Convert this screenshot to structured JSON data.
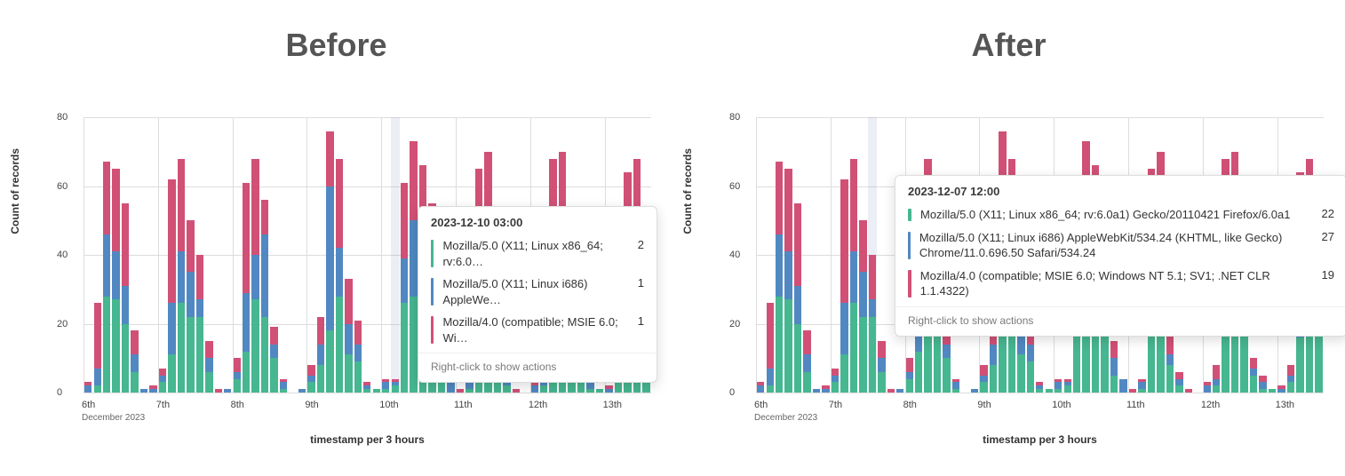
{
  "titles": {
    "before": "Before",
    "after": "After"
  },
  "axis": {
    "ylabel": "Count of records",
    "xlabel": "timestamp per 3 hours",
    "yticks": [
      0,
      20,
      40,
      60,
      80
    ],
    "ymax": 80,
    "xticks": [
      "6th",
      "7th",
      "8th",
      "9th",
      "10th",
      "11th",
      "12th",
      "13th"
    ],
    "xsub": "December 2023"
  },
  "colors": {
    "a": "#46b790",
    "b": "#5188c2",
    "c": "#d15076"
  },
  "legend_names": {
    "a": "Mozilla/5.0 (X11; Linux x86_64; rv:6.0a1) Gecko/20110421 Firefox/6.0a1",
    "b": "Mozilla/5.0 (X11; Linux i686) AppleWebKit/534.24 (KHTML, like Gecko) Chrome/11.0.696.50 Safari/534.24",
    "c": "Mozilla/4.0 (compatible; MSIE 6.0; Windows NT 5.1; SV1; .NET CLR 1.1.4322)"
  },
  "tooltips": {
    "before": {
      "title": "2023-12-10 03:00",
      "rows": [
        {
          "swatch": "a",
          "label": "Mozilla/5.0 (X11; Linux x86_64; rv:6.0…",
          "value": 2
        },
        {
          "swatch": "b",
          "label": "Mozilla/5.0 (X11; Linux i686) AppleWe…",
          "value": 1
        },
        {
          "swatch": "c",
          "label": "Mozilla/4.0 (compatible; MSIE 6.0; Wi…",
          "value": 1
        }
      ],
      "footer": "Right-click to show actions"
    },
    "after": {
      "title": "2023-12-07 12:00",
      "rows": [
        {
          "swatch": "a",
          "label": "Mozilla/5.0 (X11; Linux x86_64; rv:6.0a1) Gecko/20110421 Firefox/6.0a1",
          "value": 22
        },
        {
          "swatch": "b",
          "label": "Mozilla/5.0 (X11; Linux i686) AppleWebKit/534.24 (KHTML, like Gecko) Chrome/11.0.696.50 Safari/534.24",
          "value": 27
        },
        {
          "swatch": "c",
          "label": "Mozilla/4.0 (compatible; MSIE 6.0; Windows NT 5.1; SV1; .NET CLR 1.1.4322)",
          "value": 19
        }
      ],
      "footer": "Right-click to show actions"
    }
  },
  "chart_data": [
    {
      "id": "before",
      "type": "bar",
      "stacked": true,
      "title": "Before",
      "xlabel": "timestamp per 3 hours",
      "ylabel": "Count of records",
      "ylim": [
        0,
        80
      ],
      "x_start": "2023-12-06T00:00",
      "x_step_hours": 3,
      "x_day_ticks": [
        "6th",
        "7th",
        "8th",
        "9th",
        "10th",
        "11th",
        "12th",
        "13th"
      ],
      "x_sublabel": "December 2023",
      "series_names": [
        "Mozilla/5.0 (X11; Linux x86_64…)",
        "Mozilla/5.0 (X11; Linux i686…)",
        "Mozilla/4.0 (compatible; MSIE 6.0…)"
      ],
      "stacks": [
        {
          "a": 0,
          "b": 2,
          "c": 1
        },
        {
          "a": 2,
          "b": 5,
          "c": 19
        },
        {
          "a": 28,
          "b": 18,
          "c": 21
        },
        {
          "a": 27,
          "b": 14,
          "c": 24
        },
        {
          "a": 20,
          "b": 11,
          "c": 24
        },
        {
          "a": 6,
          "b": 5,
          "c": 7
        },
        {
          "a": 0,
          "b": 1,
          "c": 0
        },
        {
          "a": 0,
          "b": 1,
          "c": 1
        },
        {
          "a": 3,
          "b": 2,
          "c": 2
        },
        {
          "a": 11,
          "b": 15,
          "c": 36
        },
        {
          "a": 26,
          "b": 15,
          "c": 27
        },
        {
          "a": 22,
          "b": 13,
          "c": 15
        },
        {
          "a": 22,
          "b": 5,
          "c": 13
        },
        {
          "a": 6,
          "b": 4,
          "c": 5
        },
        {
          "a": 0,
          "b": 0,
          "c": 1
        },
        {
          "a": 0,
          "b": 1,
          "c": 0
        },
        {
          "a": 4,
          "b": 2,
          "c": 4
        },
        {
          "a": 12,
          "b": 17,
          "c": 32
        },
        {
          "a": 27,
          "b": 13,
          "c": 28
        },
        {
          "a": 22,
          "b": 24,
          "c": 10
        },
        {
          "a": 10,
          "b": 4,
          "c": 5
        },
        {
          "a": 1,
          "b": 2,
          "c": 1
        },
        {
          "a": 0,
          "b": 0,
          "c": 0
        },
        {
          "a": 0,
          "b": 1,
          "c": 0
        },
        {
          "a": 3,
          "b": 2,
          "c": 3
        },
        {
          "a": 8,
          "b": 6,
          "c": 8
        },
        {
          "a": 18,
          "b": 42,
          "c": 16
        },
        {
          "a": 28,
          "b": 14,
          "c": 26
        },
        {
          "a": 11,
          "b": 9,
          "c": 13
        },
        {
          "a": 9,
          "b": 5,
          "c": 7
        },
        {
          "a": 1,
          "b": 1,
          "c": 1
        },
        {
          "a": 1,
          "b": 0,
          "c": 0
        },
        {
          "a": 1,
          "b": 2,
          "c": 1
        },
        {
          "a": 2,
          "b": 1,
          "c": 1
        },
        {
          "a": 26,
          "b": 13,
          "c": 22
        },
        {
          "a": 28,
          "b": 22,
          "c": 23
        },
        {
          "a": 29,
          "b": 15,
          "c": 22
        },
        {
          "a": 24,
          "b": 11,
          "c": 20
        },
        {
          "a": 5,
          "b": 5,
          "c": 5
        },
        {
          "a": 0,
          "b": 4,
          "c": 0
        },
        {
          "a": 0,
          "b": 0,
          "c": 1
        },
        {
          "a": 1,
          "b": 2,
          "c": 1
        },
        {
          "a": 24,
          "b": 13,
          "c": 28
        },
        {
          "a": 29,
          "b": 15,
          "c": 26
        },
        {
          "a": 8,
          "b": 3,
          "c": 7
        },
        {
          "a": 2,
          "b": 2,
          "c": 2
        },
        {
          "a": 0,
          "b": 0,
          "c": 1
        },
        {
          "a": 0,
          "b": 0,
          "c": 0
        },
        {
          "a": 0,
          "b": 2,
          "c": 1
        },
        {
          "a": 2,
          "b": 2,
          "c": 4
        },
        {
          "a": 25,
          "b": 18,
          "c": 25
        },
        {
          "a": 30,
          "b": 16,
          "c": 24
        },
        {
          "a": 24,
          "b": 8,
          "c": 18
        },
        {
          "a": 5,
          "b": 2,
          "c": 3
        },
        {
          "a": 1,
          "b": 2,
          "c": 2
        },
        {
          "a": 1,
          "b": 0,
          "c": 0
        },
        {
          "a": 0,
          "b": 1,
          "c": 1
        },
        {
          "a": 3,
          "b": 2,
          "c": 3
        },
        {
          "a": 16,
          "b": 16,
          "c": 32
        },
        {
          "a": 30,
          "b": 14,
          "c": 24
        },
        {
          "a": 28,
          "b": 10,
          "c": 16
        }
      ],
      "highlight_index": 33,
      "tooltip_anchor_index": 33
    },
    {
      "id": "after",
      "type": "bar",
      "stacked": true,
      "title": "After",
      "xlabel": "timestamp per 3 hours",
      "ylabel": "Count of records",
      "ylim": [
        0,
        80
      ],
      "x_start": "2023-12-06T00:00",
      "x_step_hours": 3,
      "x_day_ticks": [
        "6th",
        "7th",
        "8th",
        "9th",
        "10th",
        "11th",
        "12th",
        "13th"
      ],
      "x_sublabel": "December 2023",
      "series_names": [
        "Mozilla/5.0 (X11; Linux x86_64…)",
        "Mozilla/5.0 (X11; Linux i686…)",
        "Mozilla/4.0 (compatible; MSIE 6.0…)"
      ],
      "stacks": "same_as_before",
      "highlight_index": 12,
      "tooltip_anchor_index": 12
    }
  ]
}
